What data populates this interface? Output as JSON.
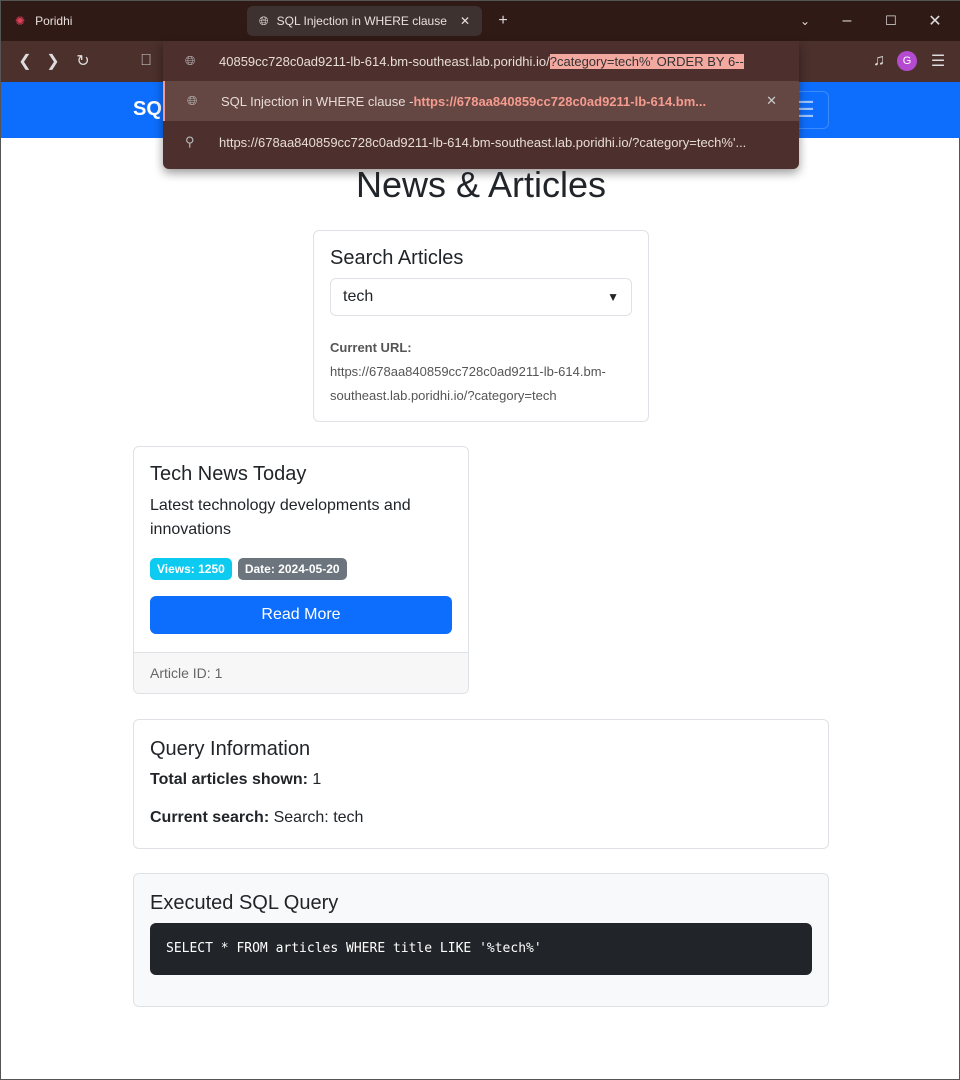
{
  "browser": {
    "tabs": [
      {
        "label": "Poridhi"
      },
      {
        "label": "SQL Injection in WHERE clause"
      }
    ],
    "address_dropdown": {
      "typed_prefix": "40859cc728c0ad9211-lb-614.bm-southeast.lab.poridhi.io/",
      "typed_highlight": "?category=tech%' ORDER BY 6--",
      "suggestion_title": "SQL Injection in WHERE clause - ",
      "suggestion_url": "https://678aa840859cc728c0ad9211-lb-614.bm...",
      "search_suggestion": "https://678aa840859cc728c0ad9211-lb-614.bm-southeast.lab.poridhi.io/?category=tech%'..."
    }
  },
  "navbar": {
    "brand": "SQL"
  },
  "page": {
    "title": "News & Articles",
    "search": {
      "heading": "Search Articles",
      "selected": "tech",
      "url_label": "Current URL:",
      "url_value": "https://678aa840859cc728c0ad9211-lb-614.bm-southeast.lab.poridhi.io/?category=tech"
    },
    "article": {
      "title": "Tech News Today",
      "description": "Latest technology developments and innovations",
      "views": "Views: 1250",
      "date": "Date: 2024-05-20",
      "button": "Read More",
      "footer": "Article ID: 1"
    },
    "query_info": {
      "heading": "Query Information",
      "total_label": "Total articles shown:",
      "total_value": "1",
      "search_label": "Current search:",
      "search_value": "Search: tech"
    },
    "sql": {
      "heading": "Executed SQL Query",
      "query": "SELECT * FROM articles WHERE title LIKE '%tech%'"
    }
  },
  "colors": {
    "primary": "#0d6efd",
    "info": "#0dcaf0",
    "secondary": "#6c757d",
    "code_bg": "#212529"
  }
}
